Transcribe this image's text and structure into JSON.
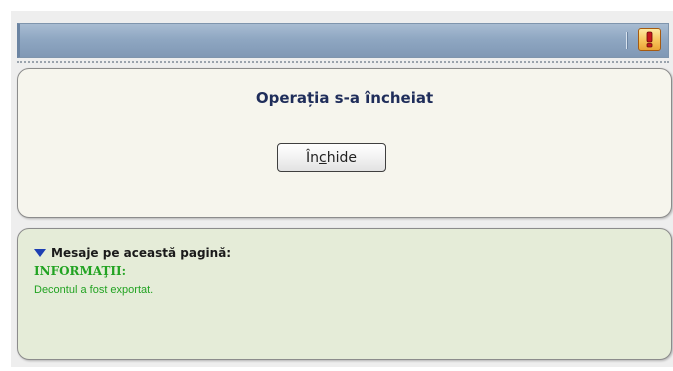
{
  "header": {
    "alert_icon": "exclamation-icon",
    "alert_color": "#f5b642"
  },
  "dialog": {
    "title": "Operația s-a încheiat",
    "close_button": {
      "prefix": "În",
      "mnemonic": "c",
      "suffix": "hide"
    }
  },
  "messages": {
    "header": "Mesaje pe această pagină:",
    "toggle_icon": "triangle-down-icon",
    "info_title": "INFORMAŢII:",
    "info_text": "Decontul a fost exportat.",
    "info_color": "#22a322"
  }
}
